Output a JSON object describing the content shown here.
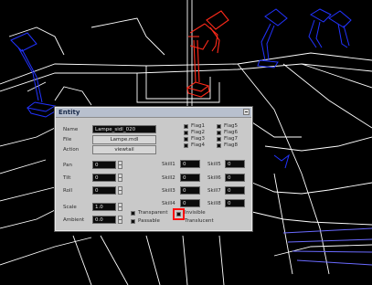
{
  "dialog": {
    "title": "Entity",
    "fields": {
      "name_label": "Name",
      "name_value": "Lampe_sidl_020",
      "file_label": "File",
      "file_button": "Lampe.mdl",
      "action_label": "Action",
      "action_button": "viewtail",
      "pan_label": "Pan",
      "pan_value": "0",
      "tilt_label": "Tilt",
      "tilt_value": "0",
      "roll_label": "Roll",
      "roll_value": "0",
      "scale_label": "Scale",
      "scale_value": "1.0",
      "ambient_label": "Ambient",
      "ambient_value": "0.0"
    },
    "flags_left": [
      "Flag1",
      "Flag2",
      "Flag3",
      "Flag4"
    ],
    "flags_right": [
      "Flag5",
      "Flag6",
      "Flag7",
      "Flag8"
    ],
    "skills": {
      "skill1_label": "Skill1",
      "skill1_value": "0",
      "skill2_label": "Skill2",
      "skill2_value": "0",
      "skill3_label": "Skill3",
      "skill3_value": "0",
      "skill4_label": "Skill4",
      "skill4_value": "0",
      "skill5_label": "Skill5",
      "skill5_value": "0",
      "skill6_label": "Skill6",
      "skill6_value": "0",
      "skill7_label": "Skill7",
      "skill7_value": "0",
      "skill8_label": "Skill8",
      "skill8_value": "0"
    },
    "options": {
      "transparent": "Transparent",
      "invisible": "Invisible",
      "passable": "Passable",
      "translucent": "Translucent"
    }
  },
  "colors": {
    "wireframe": "#ffffff",
    "selected_entity": "#ff2a1a",
    "other_entities": "#2233ff",
    "highlight": "#ff1010"
  }
}
